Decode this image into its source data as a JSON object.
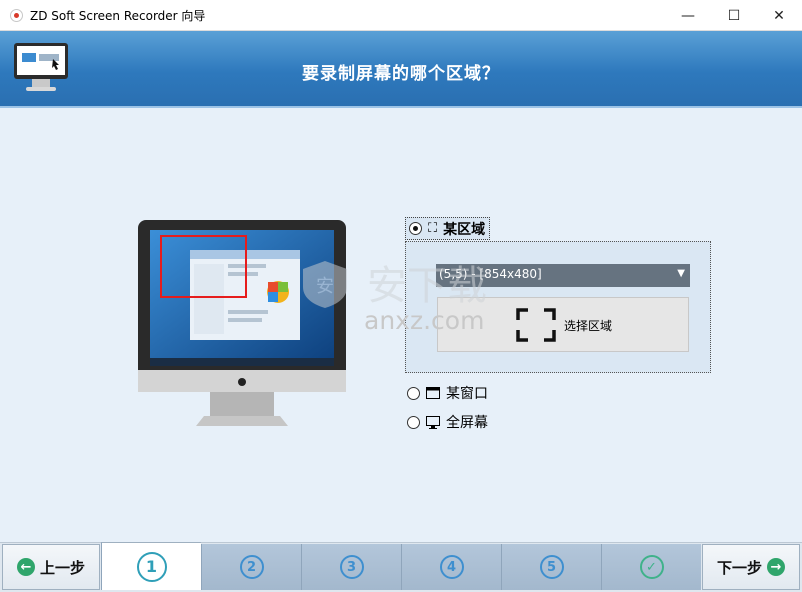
{
  "window": {
    "title": "ZD Soft Screen Recorder 向导",
    "controls": {
      "minimize": "—",
      "maximize": "☐",
      "close": "✕"
    }
  },
  "header": {
    "title": "要录制屏幕的哪个区域？"
  },
  "options": {
    "region": {
      "label": "某区域",
      "selected": true,
      "icon": "region-bracket-icon"
    },
    "window": {
      "label": "某窗口",
      "selected": false,
      "icon": "window-icon"
    },
    "fullscreen": {
      "label": "全屏幕",
      "selected": false,
      "icon": "monitor-icon"
    }
  },
  "region_panel": {
    "dropdown_value": "(5,5) - [854x480]",
    "select_button_label": "选择区域"
  },
  "watermark": {
    "url": "anxz.com"
  },
  "footer": {
    "prev_label": "上一步",
    "next_label": "下一步",
    "steps": [
      "1",
      "2",
      "3",
      "4",
      "5",
      "✓"
    ],
    "active_step": 1
  },
  "colors": {
    "header": "#2e79bd",
    "selection_rect": "#e61c1c",
    "dropdown": "#667380",
    "step_accent": "#3e8fcf",
    "nav_arrow": "#2fa56b"
  }
}
